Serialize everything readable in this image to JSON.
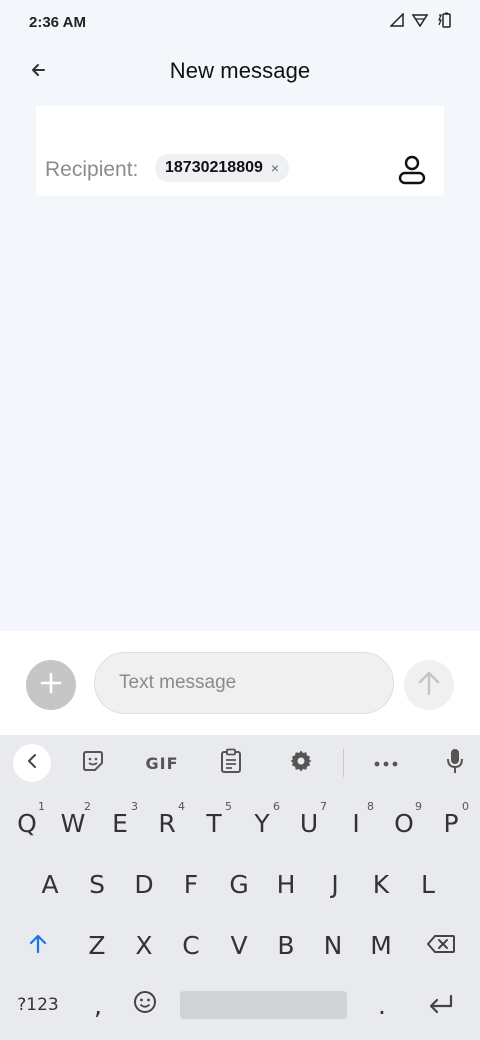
{
  "status_bar": {
    "time": "2:36 AM"
  },
  "header": {
    "title": "New message"
  },
  "recipient": {
    "label": "Recipient:",
    "chip_text": "18730218809",
    "chip_close": "×"
  },
  "compose": {
    "placeholder": "Text message"
  },
  "keyboard": {
    "toolbar": {
      "gif": "GIF"
    },
    "row1": [
      {
        "key": "Q",
        "hint": "1"
      },
      {
        "key": "W",
        "hint": "2"
      },
      {
        "key": "E",
        "hint": "3"
      },
      {
        "key": "R",
        "hint": "4"
      },
      {
        "key": "T",
        "hint": "5"
      },
      {
        "key": "Y",
        "hint": "6"
      },
      {
        "key": "U",
        "hint": "7"
      },
      {
        "key": "I",
        "hint": "8"
      },
      {
        "key": "O",
        "hint": "9"
      },
      {
        "key": "P",
        "hint": "0"
      }
    ],
    "row2": [
      "A",
      "S",
      "D",
      "F",
      "G",
      "H",
      "J",
      "K",
      "L"
    ],
    "row3": [
      "Z",
      "X",
      "C",
      "V",
      "B",
      "N",
      "M"
    ],
    "row4": {
      "symbols": "?123",
      "comma": ",",
      "period": "."
    }
  },
  "icons": {
    "back": "arrow-left-icon",
    "contact": "contact-person-icon",
    "add": "plus-icon",
    "send": "arrow-up-icon",
    "signal": "signal-icon",
    "wifi": "wifi-icon",
    "battery": "battery-icon",
    "sticker": "sticker-icon",
    "clipboard": "clipboard-icon",
    "settings": "gear-icon",
    "more": "more-dots-icon",
    "mic": "microphone-icon",
    "shift": "shift-arrow-icon",
    "backspace": "backspace-icon",
    "emoji": "emoji-icon",
    "enter": "enter-icon"
  },
  "colors": {
    "accent_shift": "#1a73e8",
    "background": "#f3f6fb"
  }
}
